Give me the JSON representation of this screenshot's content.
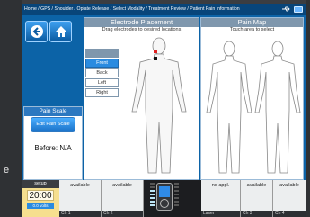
{
  "side_text": "e",
  "header": {
    "breadcrumb": "Home / GPS / Shoulder / Opiate Release / Select Modality / Treatment Review / Patient Pain Information",
    "usb_icon": "usb-icon",
    "battery_icon": "battery-icon"
  },
  "nav": {
    "back_icon": "back-arrow-icon",
    "home_icon": "home-icon"
  },
  "electrode_placement": {
    "title": "Electrode Placement",
    "instruction": "Drag electrodes to desired locations",
    "view_tabs": [
      {
        "label": "Bl...",
        "selected": false
      },
      {
        "label": "Front",
        "selected": true
      },
      {
        "label": "Back",
        "selected": false
      },
      {
        "label": "Left",
        "selected": false
      },
      {
        "label": "Right",
        "selected": false
      }
    ],
    "marker_colors": [
      "#e02020",
      "#111111"
    ]
  },
  "pain_map": {
    "title": "Pain Map",
    "instruction": "Touch area to select"
  },
  "pain_scale": {
    "title": "Pain Scale",
    "edit_button": "Edit Pain Scale",
    "before": "Before: N/A"
  },
  "channels": {
    "setup": {
      "label": "setup",
      "time": "20:00",
      "volts": "0.0 volts"
    },
    "slots": [
      {
        "status": "available",
        "foot": "Ch 1"
      },
      {
        "status": "available",
        "foot": "Ch 2"
      },
      {
        "status": "available",
        "foot": "US"
      },
      {
        "status": "no appl.",
        "foot": "Laser"
      },
      {
        "status": "available",
        "foot": "Ch 3"
      },
      {
        "status": "available",
        "foot": "Ch 4"
      }
    ]
  }
}
